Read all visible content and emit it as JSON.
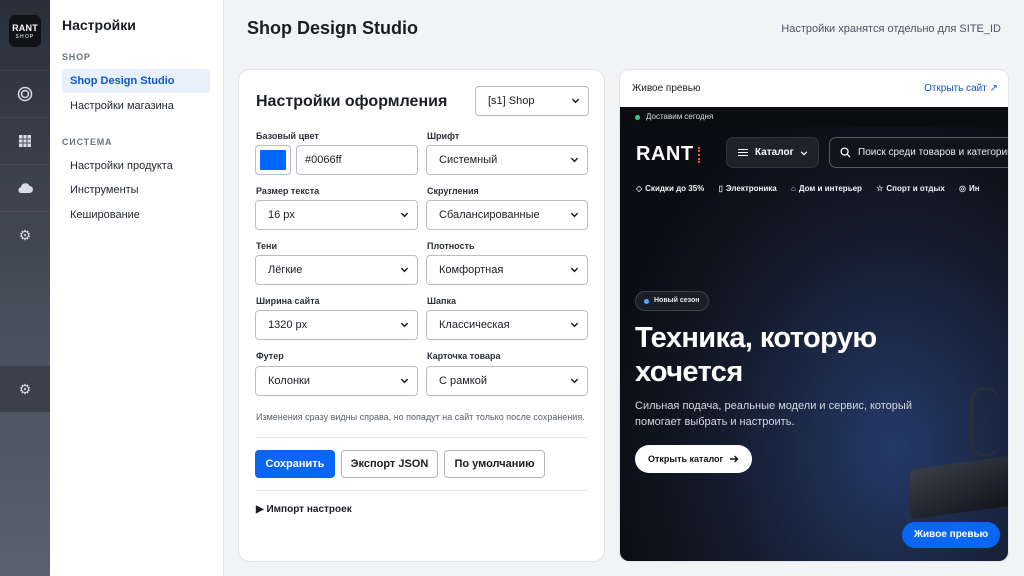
{
  "rail": {
    "logo_line1": "RANT",
    "logo_line2": "SHOP",
    "items": [
      {
        "name": "target-icon"
      },
      {
        "name": "grid-icon"
      },
      {
        "name": "cloud-icon"
      },
      {
        "name": "gear-icon"
      },
      {
        "name": "gear-icon",
        "active": true
      }
    ]
  },
  "sidebar": {
    "title": "Настройки",
    "section_shop": "SHOP",
    "item_design_studio": "Shop Design Studio",
    "item_store_settings": "Настройки магазина",
    "section_system": "СИСТЕМА",
    "item_product_settings": "Настройки продукта",
    "item_tools": "Инструменты",
    "item_caching": "Кеширование"
  },
  "header": {
    "title": "Shop Design Studio",
    "note": "Настройки хранятся отдельно для SITE_ID"
  },
  "form": {
    "title": "Настройки оформления",
    "site_select": "[s1] Shop",
    "base_color_label": "Базовый цвет",
    "base_color_value": "#0066ff",
    "font_label": "Шрифт",
    "font_value": "Системный",
    "text_size_label": "Размер текста",
    "text_size_value": "16 px",
    "rounding_label": "Скругления",
    "rounding_value": "Сбалансированные",
    "shadows_label": "Тени",
    "shadows_value": "Лёгкие",
    "density_label": "Плотность",
    "density_value": "Комфортная",
    "width_label": "Ширина сайта",
    "width_value": "1320 px",
    "header_label": "Шапка",
    "header_value": "Классическая",
    "footer_label": "Футер",
    "footer_value": "Колонки",
    "card_label": "Карточка товара",
    "card_value": "С рамкой",
    "hint": "Изменения сразу видны справа, но попадут на сайт только после сохранения.",
    "save_label": "Сохранить",
    "export_label": "Экспорт JSON",
    "default_label": "По умолчанию",
    "import_label": "▶ Импорт настроек"
  },
  "preview": {
    "title": "Живое превью",
    "open_site": "Открыть сайт ↗",
    "delivery": "Доставим сегодня",
    "brand": "RANT",
    "catalog": "Каталог",
    "search_placeholder": "Поиск среди товаров и категорий",
    "categories": [
      {
        "icon": "tag-icon",
        "glyph": "◇",
        "label": "Скидки до 35%"
      },
      {
        "icon": "phone-icon",
        "glyph": "▯",
        "label": "Электроника"
      },
      {
        "icon": "home-icon",
        "glyph": "⌂",
        "label": "Дом и интерьер"
      },
      {
        "icon": "star-icon",
        "glyph": "☆",
        "label": "Спорт и отдых"
      },
      {
        "icon": "shield-icon",
        "glyph": "◎",
        "label": "Ин"
      }
    ],
    "badge": "Новый сезон",
    "headline": "Техника, которую хочется",
    "subtitle": "Сильная подача, реальные модели и сервис, который помогает выбрать и настроить.",
    "cta": "Открыть каталог",
    "fab": "Живое превью"
  },
  "colors": {
    "accent": "#0066ff",
    "link": "#0b57c9"
  }
}
